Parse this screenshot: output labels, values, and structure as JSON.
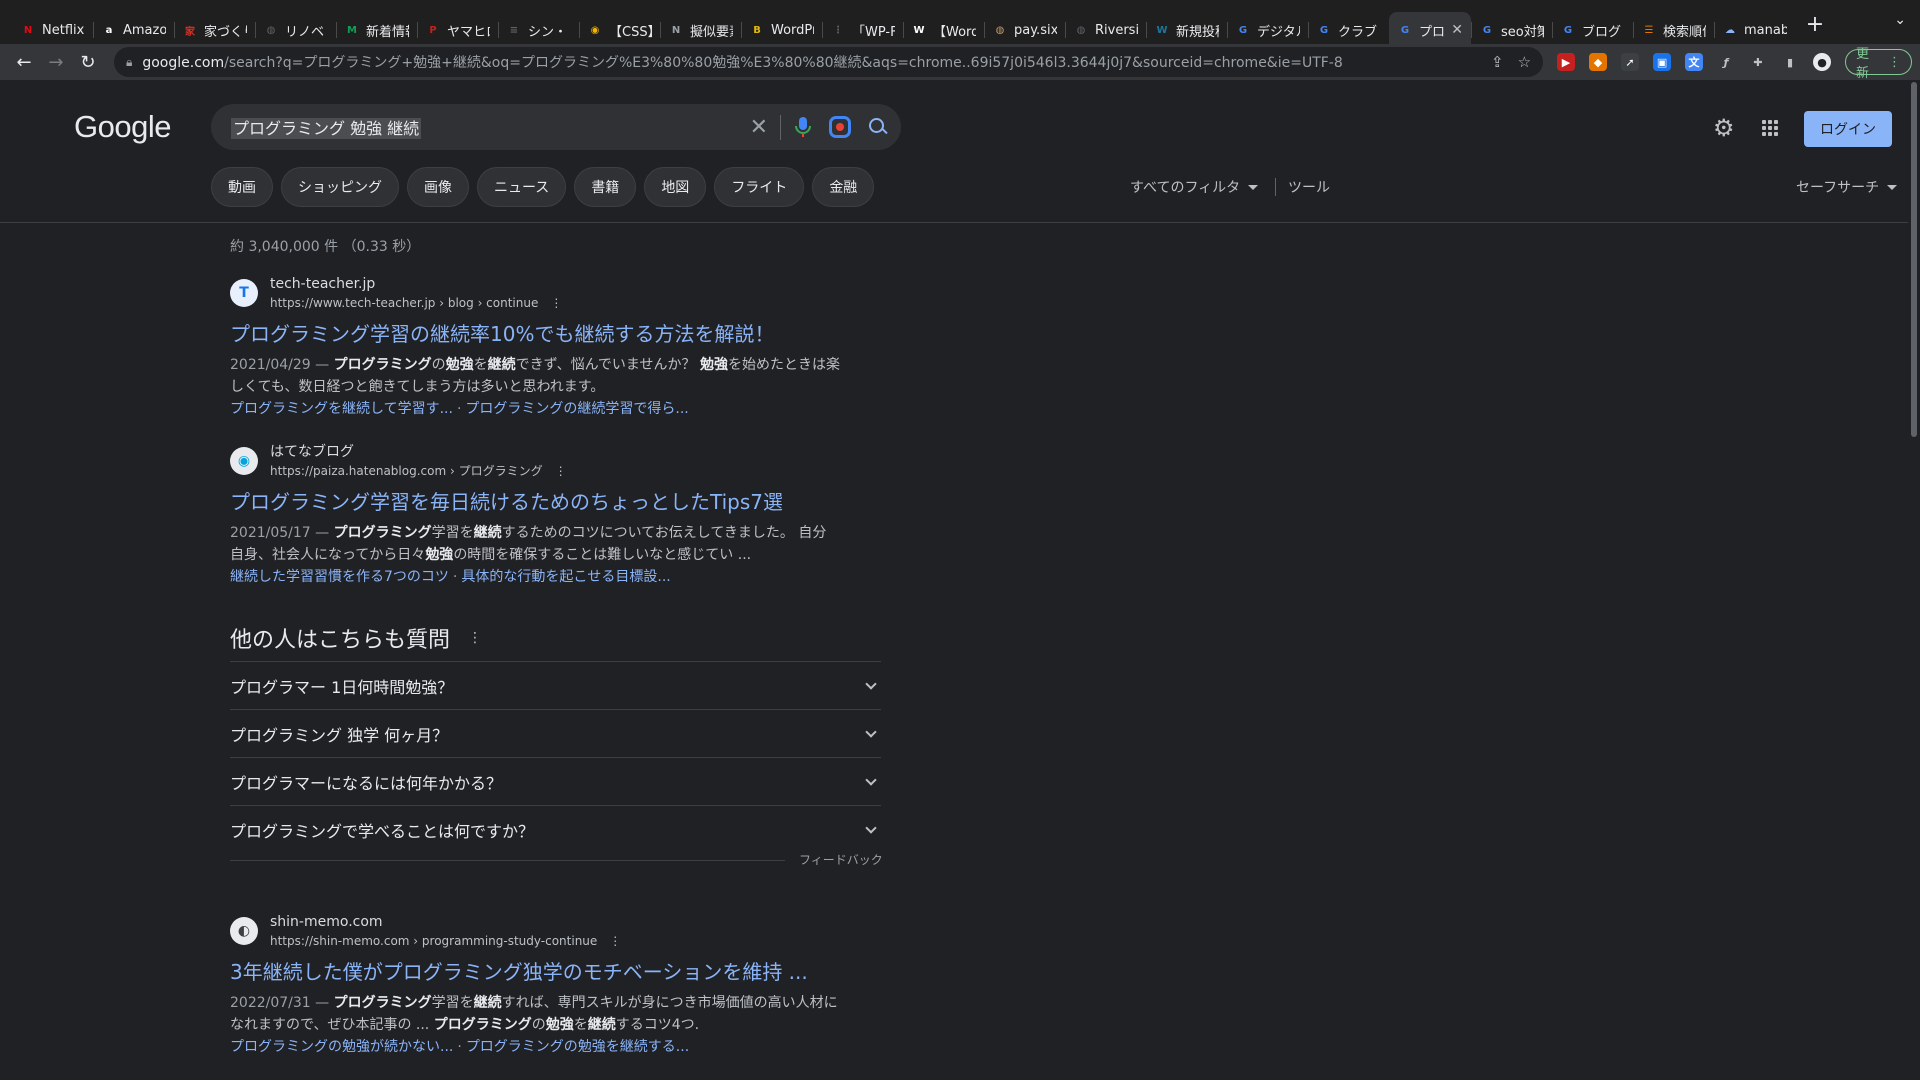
{
  "browser": {
    "tabs": [
      {
        "label": "Netflix",
        "fav": "N",
        "color": "#e50914"
      },
      {
        "label": "Amazon",
        "fav": "a",
        "color": "#ffffff"
      },
      {
        "label": "家づくり",
        "fav": "家",
        "color": "#d93025"
      },
      {
        "label": "リノベ",
        "fav": "◍",
        "color": "#5f6368"
      },
      {
        "label": "新着情報",
        "fav": "M",
        "color": "#0f9d58"
      },
      {
        "label": "ヤマヒロ",
        "fav": "P",
        "color": "#c5221f"
      },
      {
        "label": "シン・",
        "fav": "≡",
        "color": "#5f6368"
      },
      {
        "label": "【CSS】",
        "fav": "◉",
        "color": "#f4b400"
      },
      {
        "label": "擬似要素",
        "fav": "N",
        "color": "#9aa0a6"
      },
      {
        "label": "WordPre",
        "fav": "B",
        "color": "#e2b714"
      },
      {
        "label": "「WP-F",
        "fav": "⋮",
        "color": "#5f6368"
      },
      {
        "label": "【Word",
        "fav": "W",
        "color": "#ffffff"
      },
      {
        "label": "pay.six",
        "fav": "◍",
        "color": "#c49a6c"
      },
      {
        "label": "Riversi",
        "fav": "◍",
        "color": "#5f6368"
      },
      {
        "label": "新規投稿",
        "fav": "W",
        "color": "#21759b"
      },
      {
        "label": "デジタル",
        "fav": "G",
        "color": "#4285f4"
      },
      {
        "label": "クラブ",
        "fav": "G",
        "color": "#4285f4"
      },
      {
        "label": "プロ",
        "fav": "G",
        "color": "#4285f4",
        "active": true
      },
      {
        "label": "seo対策",
        "fav": "G",
        "color": "#4285f4"
      },
      {
        "label": "ブログ",
        "fav": "G",
        "color": "#4285f4"
      },
      {
        "label": "検索順位",
        "fav": "☰",
        "color": "#e37400"
      },
      {
        "label": "manab",
        "fav": "☁",
        "color": "#8ab4f8"
      }
    ],
    "url_host": "google.com",
    "url_rest": "/search?q=プログラミング+勉強+継続&oq=プログラミング%E3%80%80勉強%E3%80%80継続&aqs=chrome..69i57j0i546l3.3644j0j7&sourceid=chrome&ie=UTF-8",
    "update_label": "更新"
  },
  "google": {
    "logo": "Google",
    "query": "プログラミング 勉強 継続",
    "login": "ログイン",
    "chips": [
      "動画",
      "ショッピング",
      "画像",
      "ニュース",
      "書籍",
      "地図",
      "フライト",
      "金融"
    ],
    "all_filters": "すべてのフィルタ",
    "tools": "ツール",
    "safesearch": "セーフサーチ",
    "stats": "約 3,040,000 件 （0.33 秒）"
  },
  "results": [
    {
      "site": "tech-teacher.jp",
      "cite": "https://www.tech-teacher.jp › blog › continue",
      "fav": "T",
      "title": "プログラミング学習の継続率10%でも継続する方法を解説！",
      "date": "2021/04/29 — ",
      "snippet_html": "<b>プログラミング</b>の<b>勉強</b>を<b>継続</b>できず、悩んでいませんか？ <b>勉強</b>を始めたときは楽しくても、数日経つと飽きてしまう方は多いと思われます。",
      "link1": "プログラミングを継続して学習す...",
      "link2": "プログラミングの継続学習で得ら..."
    },
    {
      "site": "はてなブログ",
      "cite": "https://paiza.hatenablog.com › プログラミング",
      "fav": "◉",
      "title": "プログラミング学習を毎日続けるためのちょっとしたTips7選",
      "date": "2021/05/17 — ",
      "snippet_html": "<b>プログラミング</b>学習を<b>継続</b>するためのコツについてお伝えしてきました。 自分自身、社会人になってから日々<b>勉強</b>の時間を確保することは難しいなと感じてい ...",
      "link1": "継続した学習習慣を作る7つのコツ",
      "link2": "具体的な行動を起こせる目標設..."
    },
    {
      "site": "shin-memo.com",
      "cite": "https://shin-memo.com › programming-study-continue",
      "fav": "◐",
      "title": "3年継続した僕がプログラミング独学のモチベーションを維持 ...",
      "date": "2022/07/31 — ",
      "snippet_html": "<b>プログラミング</b>学習を<b>継続</b>すれば、専門スキルが身につき市場価値の高い人材になれますので、ぜひ本記事の ... <b>プログラミング</b>の<b>勉強</b>を<b>継続</b>するコツ4つ.",
      "link1": "プログラミングの勉強が続かない...",
      "link2": "プログラミングの勉強を継続する..."
    }
  ],
  "paa": {
    "title": "他の人はこちらも質問",
    "questions": [
      "プログラマー 1日何時間勉強？",
      "プログラミング 独学 何ヶ月？",
      "プログラマーになるには何年かかる？",
      "プログラミングで学べることは何ですか？"
    ],
    "feedback": "フィードバック"
  }
}
